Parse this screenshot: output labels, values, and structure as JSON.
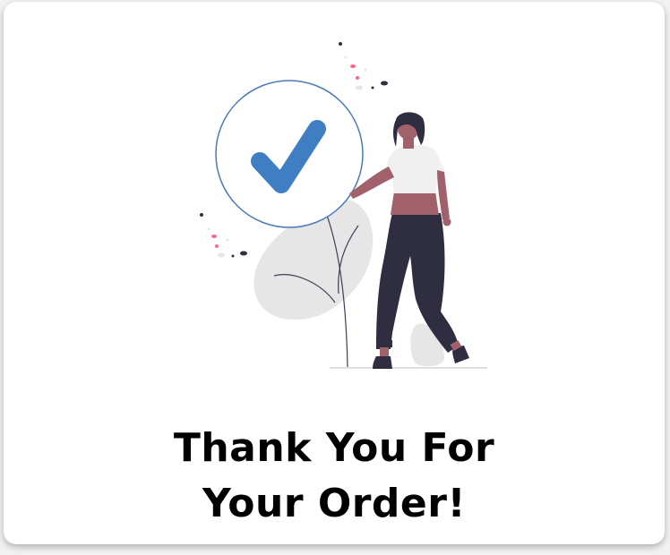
{
  "confirmation": {
    "title_line1": "Thank You For",
    "title_line2": "Your Order!"
  },
  "illustration": {
    "icon": "checkmark-circle-icon",
    "check_color": "#3f7ec2",
    "circle_stroke": "#4a7bb5",
    "skin_color": "#a0616a",
    "pants_color": "#2f2e41",
    "hair_color": "#2f2e41",
    "shirt_color": "#f0f0f0",
    "plant_color": "#e6e6e6",
    "accent_pink": "#ff6584"
  }
}
